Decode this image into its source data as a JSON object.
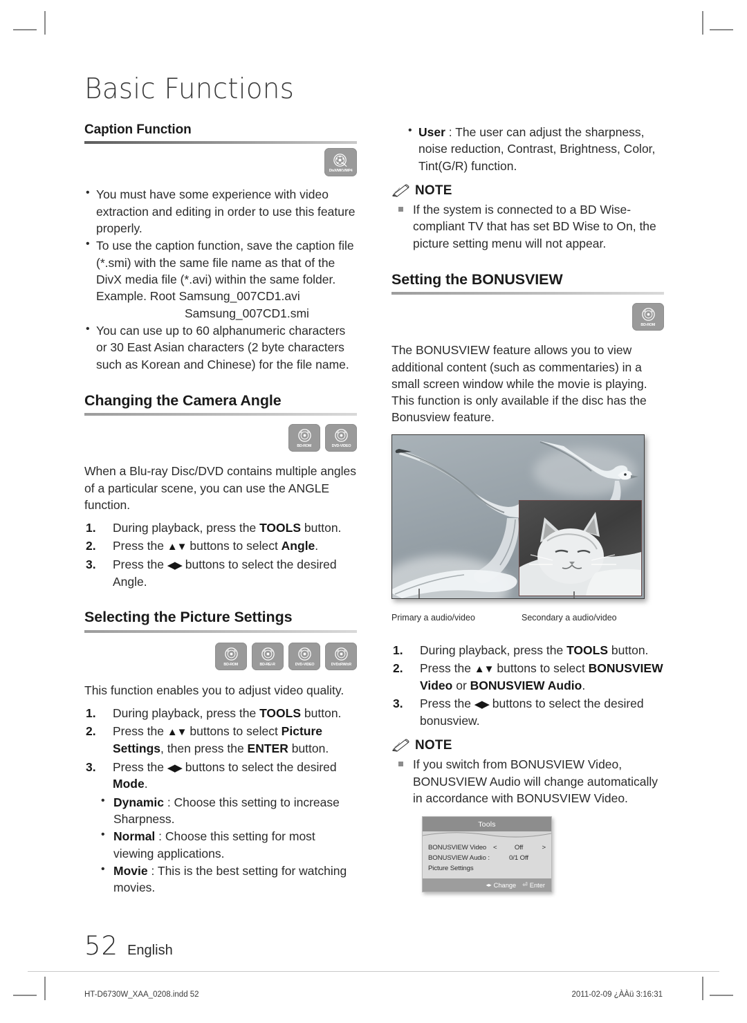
{
  "document": {
    "chapter_title": "Basic Functions",
    "page_number": "52",
    "language": "English",
    "footer_file": "HT-D6730W_XAA_0208.indd   52",
    "footer_timestamp": "2011-02-09   ¿ÀÀü 3:16:31"
  },
  "left_column": {
    "caption_section": {
      "heading": "Caption Function",
      "badges": [
        {
          "icon": "disc-icon",
          "name": "DivX/MKV/MP4"
        }
      ],
      "bullets": [
        "You must have some experience with video extraction and editing in order to use this feature properly.",
        "To use the caption function, save the caption file (*.smi) with the same file name as that of the DivX media file (*.avi) within the same folder. Example. Root Samsung_007CD1.avi",
        "You can use up to 60 alphanumeric characters or 30 East Asian characters (2 byte characters such as Korean and Chinese) for the file name."
      ],
      "example_second_line": "Samsung_007CD1.smi"
    },
    "angle_section": {
      "heading": "Changing the Camera Angle",
      "badges": [
        {
          "icon": "disc-icon",
          "name": "BD-ROM"
        },
        {
          "icon": "disc-icon",
          "name": "DVD-VIDEO"
        }
      ],
      "intro": "When a Blu-ray Disc/DVD contains multiple angles of a particular scene, you can use the ANGLE function.",
      "steps": [
        {
          "pre": "During playback, press the ",
          "bold": "TOOLS",
          "post": " button."
        },
        {
          "pre": "Press the ",
          "arrows": "▲▼",
          "mid": " buttons to select ",
          "bold": "Angle",
          "post": "."
        },
        {
          "pre": "Press the ",
          "arrows": "◀▶",
          "mid": " buttons to select the desired Angle.",
          "bold": "",
          "post": ""
        }
      ]
    },
    "picture_section": {
      "heading": "Selecting the Picture Settings",
      "badges": [
        {
          "icon": "disc-icon",
          "name": "BD-ROM"
        },
        {
          "icon": "disc-icon",
          "name": "BD-RE/-R"
        },
        {
          "icon": "disc-icon",
          "name": "DVD-VIDEO"
        },
        {
          "icon": "disc-icon",
          "name": "DVD±RW/±R"
        }
      ],
      "intro": "This function enables you to adjust video quality.",
      "steps": [
        {
          "pre": "During playback, press the ",
          "bold": "TOOLS",
          "post": " button."
        },
        {
          "pre": "Press the ",
          "arrows": "▲▼",
          "mid": " buttons to select ",
          "bold": "Picture Settings",
          "post": ", then press the ",
          "bold2": "ENTER",
          "post2": " button."
        },
        {
          "pre": "Press the ",
          "arrows": "◀▶",
          "mid": " buttons to select the desired ",
          "bold": "Mode",
          "post": "."
        }
      ],
      "modes": [
        {
          "name": "Dynamic",
          "desc": " : Choose this setting to increase Sharpness."
        },
        {
          "name": "Normal",
          "desc": " : Choose this setting for most viewing applications."
        },
        {
          "name": "Movie",
          "desc": " : This is the best setting for watching movies."
        }
      ]
    }
  },
  "right_column": {
    "user_mode": {
      "name": "User",
      "desc": " : The user can adjust the sharpness, noise reduction, Contrast, Brightness, Color, Tint(G/R) function."
    },
    "note_1": {
      "label": "NOTE",
      "items": [
        "If the system is connected to a BD Wise-compliant TV that has set BD Wise to On, the picture setting menu will not appear."
      ]
    },
    "bonusview_section": {
      "heading": "Setting the BONUSVIEW",
      "badges": [
        {
          "icon": "disc-icon",
          "name": "BD-ROM"
        }
      ],
      "intro": "The BONUSVIEW feature allows you to view additional content (such as commentaries) in a small screen window while the movie is playing. This function is only available if the disc has the Bonusview feature.",
      "figure": {
        "primary_label": "Primary a audio/video",
        "secondary_label": "Secondary a audio/video"
      },
      "steps": [
        {
          "pre": "During playback, press the ",
          "bold": "TOOLS",
          "post": " button."
        },
        {
          "pre": "Press the ",
          "arrows": "▲▼",
          "mid": " buttons to select ",
          "bold": "BONUSVIEW Video",
          "mid2": " or ",
          "bold2": "BONUSVIEW Audio",
          "post": "."
        },
        {
          "pre": "Press the ",
          "arrows": "◀▶",
          "mid": " buttons to select the desired bonusview.",
          "bold": "",
          "post": ""
        }
      ]
    },
    "note_2": {
      "label": "NOTE",
      "items": [
        "If you switch from BONUSVIEW Video, BONUSVIEW Audio will change automatically in accordance with BONUSVIEW Video."
      ]
    },
    "osd": {
      "title": "Tools",
      "rows": [
        {
          "key": "BONUSVIEW Video",
          "left_arrow": "<",
          "value": "Off",
          "right_arrow": ">"
        },
        {
          "key": "BONUSVIEW Audio :",
          "left_arrow": "",
          "value": "0/1 Off",
          "right_arrow": ""
        },
        {
          "key": "Picture Settings",
          "left_arrow": "",
          "value": "",
          "right_arrow": ""
        }
      ],
      "footer": {
        "change_icon": "◂▸",
        "change_label": "Change",
        "enter_icon": "⏎",
        "enter_label": "Enter"
      }
    }
  },
  "colors": {
    "badge_gray": "#9a9a9a",
    "text": "#2b2b2b",
    "rule": "#9c9c9c",
    "osd_header": "#8d8d8d"
  }
}
